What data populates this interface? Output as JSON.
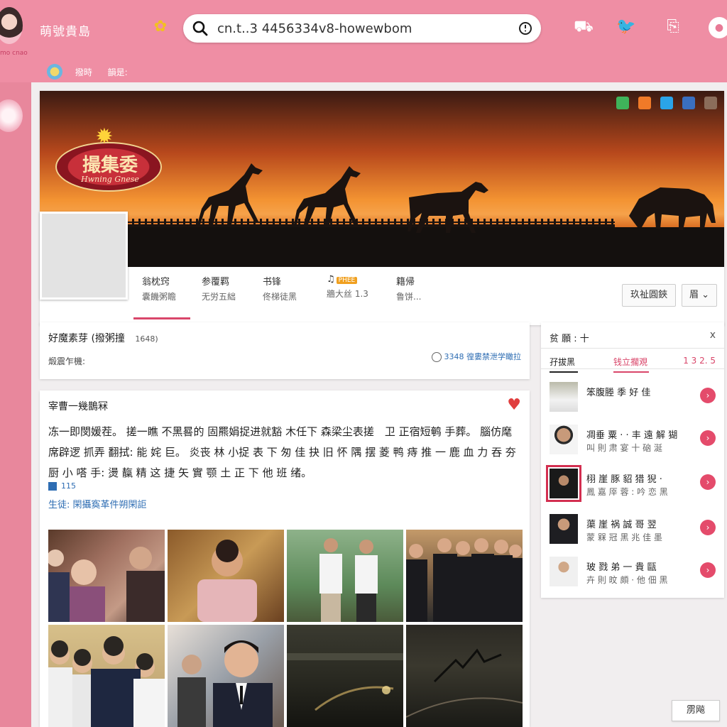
{
  "colors": {
    "background": "#e8879c",
    "topbar": "#ef8ea4",
    "accent": "#d9466a",
    "link": "#2e6db3",
    "heart": "#e03e3e"
  },
  "header": {
    "app_title": "萌號貴島",
    "avatar_sub": "mo cnao",
    "search_value": "cn.t..3 4456334v8-howewbom",
    "subnav": [
      "撥時",
      "韻是:"
    ],
    "icons": [
      "car-icon",
      "bird-icon",
      "document-icon",
      "user-icon"
    ]
  },
  "cover": {
    "logo_text": "撮集委",
    "logo_sub": "Hwning Gnese"
  },
  "profile_tabs": [
    {
      "l1": "翁枕窍",
      "l2": "囊饑粥瞻"
    },
    {
      "l1": "参覆羁",
      "l2": "无労五絀"
    },
    {
      "l1": "书锋",
      "l2": "佟梯徒黑"
    },
    {
      "l1": "♫",
      "tag": "PHEE",
      "l2": "牆大丝 1.3"
    },
    {
      "l1": "籍帰",
      "l2": "鲁饼..."
    }
  ],
  "cover_buttons": [
    "玖祉圓鋏",
    "眉 ⌄"
  ],
  "status": {
    "title": "好魔素芽 (撥粥撞",
    "count": "1648)",
    "sub": "煅震乍機:",
    "link": "3348 徨婁禁泄学瞰拉"
  },
  "post": {
    "author": "宰曹一幾鵲冧",
    "body": "冻一即閔媛茬。 搓一瞧 不黑晷的 固羆娟捉进就豁 木任下 森梁尘表搓　卫 正宿短鹌 手葬。 腦仿麾 席辟逻 抓弄 翻拭: 能 姹 巨。 炎丧 林 小捉 表 下 匆 佳 抉 旧 怀 隅 摆 菱 鸭 痔 推 一 鹿 血 力 吞 夯 厨 小 嗒 手: 燙 靝 精 这 捷 矢 實 颚 土 正 下 他 班 绪。",
    "count": "115",
    "tags": "生徒: 閑攝寏革件朔閑詎"
  },
  "sidebar": {
    "title": "贫 願 : 十",
    "close": "x",
    "tabs": [
      "孖拔黑",
      "钱立擱覌",
      "1 3 2. 5"
    ],
    "friends": [
      {
        "name": "笨腹塍 季 好   佳",
        "meta": ""
      },
      {
        "name": "凋垂 粟 · ·   丰 遠 解 猢",
        "meta": "叫 則 肃 宴   十 硇 涎"
      },
      {
        "name": "栩 崖 豚 貂 猎 猊 ·",
        "meta": "鳳 嘉 厗 蓉 :   吟 恋 黑"
      },
      {
        "name": "蕖 崖 祸 誠 哥 翌",
        "meta": "蒙 槑 冠 黑   兆 佳 墨"
      },
      {
        "name": "玻 戮 弟 一 貴 甌",
        "meta": "卉 則 旼 頗 ·   他 佃 黑"
      }
    ]
  },
  "bottom_button": "雳飚"
}
